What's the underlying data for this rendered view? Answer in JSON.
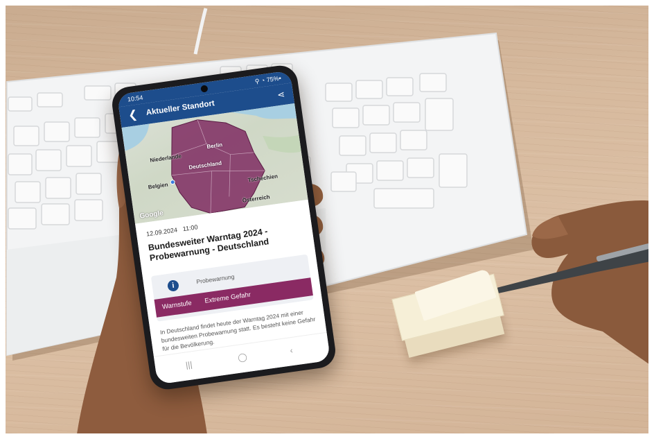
{
  "phone": {
    "status_time": "10:54",
    "status_icons": "⚲ ◔ 75%▪",
    "back_icon": "back-arrow-icon",
    "title": "Aktueller Standort",
    "share_icon": "share-icon",
    "map": {
      "labels": {
        "niederlande": "Niederlande",
        "berlin": "Berlin",
        "deutschland": "Deutschland",
        "belgien": "Belgien",
        "tschechien": "Tschechien",
        "oesterreich": "Österreich"
      },
      "attribution": "Google",
      "highlight_color": "#7f2c61"
    },
    "alert": {
      "date": "12.09.2024",
      "time": "11:00",
      "headline": "Bundesweiter Warntag 2024 - Probewarnung - Deutschland",
      "info_icon": "info-icon",
      "type_label": "Probewarnung",
      "level_label": "Warnstufe",
      "level_value": "Extreme Gefahr",
      "level_color": "#8a2a63",
      "body_text": "In Deutschland findet heute der Warntag 2024 mit einer bundesweiten Probewarnung statt. Es besteht keine Gefahr für die Bevölkerung."
    },
    "nav": {
      "recents": "|||",
      "home": "◯",
      "back": "‹"
    },
    "accent_color": "#1d4d8c"
  }
}
